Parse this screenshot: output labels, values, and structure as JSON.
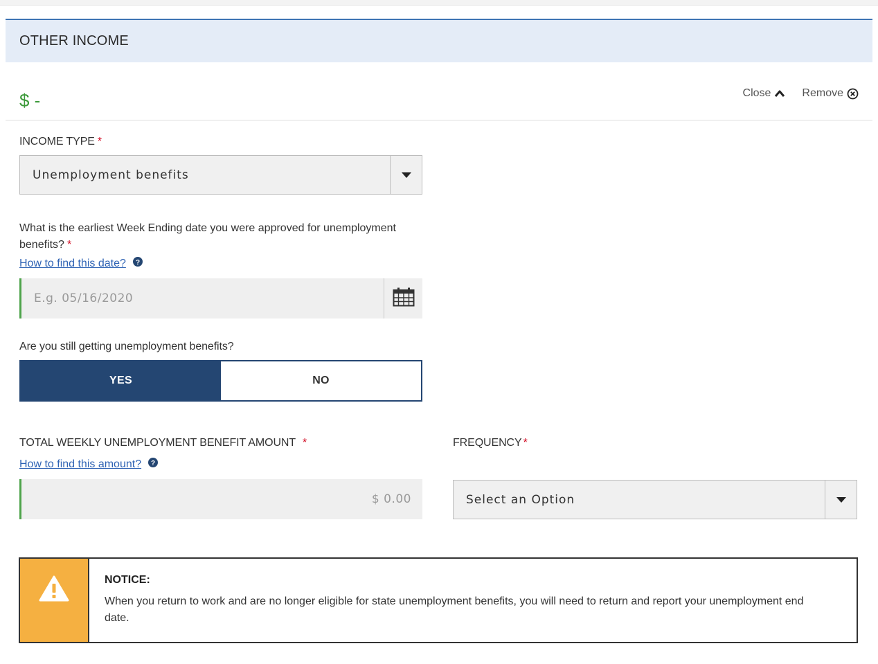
{
  "section": {
    "title": "OTHER INCOME"
  },
  "summary": {
    "amount": "$ -"
  },
  "actions": {
    "close_label": "Close",
    "remove_label": "Remove"
  },
  "income_type": {
    "label": "INCOME TYPE",
    "required_marker": "*",
    "selected": "Unemployment benefits"
  },
  "week_ending": {
    "question": "What is the earliest Week Ending date you were approved for unemployment benefits?",
    "required_marker": "*",
    "help_link": "How to find this date?",
    "placeholder": "E.g. 05/16/2020",
    "value": ""
  },
  "still_getting": {
    "question": "Are you still getting unemployment benefits?",
    "options": [
      "YES",
      "NO"
    ],
    "selected": "YES"
  },
  "weekly_amount": {
    "label": "TOTAL WEEKLY UNEMPLOYMENT BENEFIT AMOUNT",
    "required_marker": "*",
    "help_link": "How to find this amount?",
    "placeholder": "$ 0.00",
    "value": ""
  },
  "frequency": {
    "label": "FREQUENCY",
    "required_marker": "*",
    "selected": "Select an Option"
  },
  "notice": {
    "title": "NOTICE:",
    "text": "When you return to work and are no longer eligible for state unemployment benefits, you will need to return and report your unemployment end date."
  },
  "colors": {
    "header_bg": "#e4ecf7",
    "header_border": "#3e74b4",
    "amount_green": "#3c9a3a",
    "primary_navy": "#244672",
    "link_blue": "#2f63b4",
    "required_red": "#d0021b",
    "input_accent_green": "#4ea34b",
    "notice_orange": "#f5b041"
  },
  "icons": {
    "close": "chevron-up-icon",
    "remove": "circle-x-icon",
    "help": "question-circle-icon",
    "calendar": "calendar-icon",
    "dropdown": "caret-down-icon",
    "notice": "warning-triangle-icon"
  }
}
